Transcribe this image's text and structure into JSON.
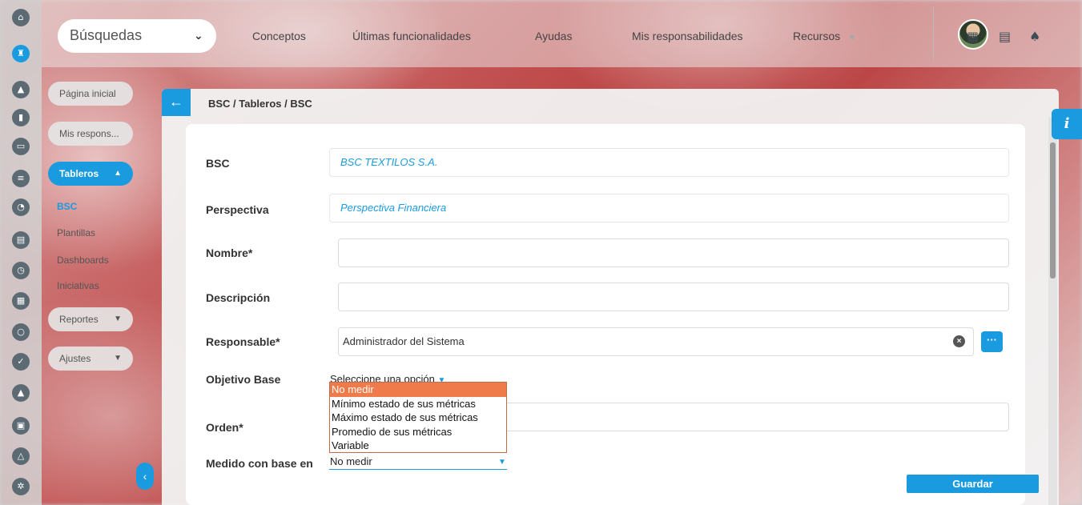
{
  "topbar": {
    "search_label": "Búsquedas",
    "nav": [
      "Conceptos",
      "Últimas funcionalidades",
      "Ayudas",
      "Mis responsabilidades",
      "Recursos"
    ]
  },
  "sidemenu": {
    "home": "Página inicial",
    "responsibilities": "Mis respons...",
    "boards": "Tableros",
    "sub_items": [
      "BSC",
      "Plantillas",
      "Dashboards",
      "Iniciativas"
    ],
    "reports": "Reportes",
    "settings": "Ajustes"
  },
  "breadcrumb": "BSC / Tableros / BSC",
  "form": {
    "bsc_label": "BSC",
    "bsc_value": "BSC TEXTILOS S.A.",
    "perspective_label": "Perspectiva",
    "perspective_value": "Perspectiva Financiera",
    "name_label": "Nombre*",
    "name_value": "",
    "description_label": "Descripción",
    "description_value": "",
    "responsible_label": "Responsable*",
    "responsible_value": "Administrador del Sistema",
    "objective_label": "Objetivo Base",
    "objective_placeholder": "Seleccione una opción",
    "order_label": "Orden*",
    "order_value": "",
    "measured_label": "Medido con base en",
    "measured_value": "No medir",
    "dropdown_options": [
      "No medir",
      "Mínimo estado de sus métricas",
      "Máximo estado de sus métricas",
      "Promedio de sus métricas",
      "Variable"
    ],
    "save_label": "Guardar"
  },
  "icons": {
    "rail": [
      "home-icon",
      "rook-icon",
      "triangle-icon",
      "bar-chart-icon",
      "presentation-icon",
      "list-icon",
      "pie-chart-icon",
      "book-icon",
      "clock-icon",
      "document-icon",
      "cycle-icon",
      "check-icon",
      "alert-icon",
      "calendar-icon",
      "network-icon",
      "gear-icon"
    ],
    "top": [
      "calendar-icon",
      "book-icon",
      "bell-icon"
    ]
  },
  "colors": {
    "accent": "#1a9be0",
    "dropdown_highlight": "#f07b4a"
  }
}
